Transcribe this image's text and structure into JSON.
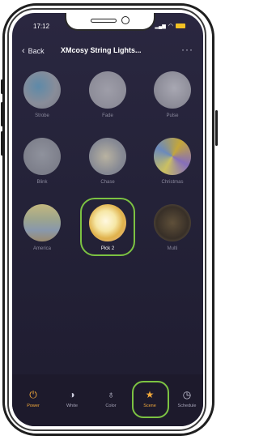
{
  "status": {
    "time": "17:12",
    "signal": "▂▄▆",
    "wifi": "wifi"
  },
  "nav": {
    "back_label": "Back",
    "title": "XMcosy String Lights...",
    "more": "···"
  },
  "scenes": [
    {
      "label": "Strobe",
      "selected": false,
      "bg": "radial-gradient(circle at 40% 40%,#6aa0c0,#9ea4ae 55%,#8c8c96)"
    },
    {
      "label": "Fade",
      "selected": false,
      "bg": "radial-gradient(circle at 50% 50%,#b8b8c0,#9a9aa4)"
    },
    {
      "label": "Pulse",
      "selected": false,
      "bg": "radial-gradient(circle at 55% 45%,#c4c4cc,#8e8e98)"
    },
    {
      "label": "Blink",
      "selected": false,
      "bg": "radial-gradient(circle at 50% 45%,#a6aab2,#868892)"
    },
    {
      "label": "Chase",
      "selected": false,
      "bg": "radial-gradient(circle at 45% 50%,#d9d2b8,#9ca0a8 60%,#8c8e96)"
    },
    {
      "label": "Christmas",
      "selected": false,
      "bg": "conic-gradient(from 30deg,#e8c33a,#9b7fd6,#f0e36a,#7aa0d8,#e8c33a)"
    },
    {
      "label": "America",
      "selected": false,
      "bg": "linear-gradient(180deg,#e6d88e,#b8c2a0 40%,#9fb2c6 70%,#b5a27a)"
    },
    {
      "label": "Pick 2",
      "selected": true,
      "bg": "radial-gradient(circle at 45% 45%,#fff8e0,#f6e7a6 35%,#e0b24c 60%,#e7b38a)"
    },
    {
      "label": "Multi",
      "selected": false,
      "bg": "radial-gradient(circle at 50% 50%,#6c5a3a,#3c3224 60%,#8a7a5a)"
    }
  ],
  "tabs": [
    {
      "label": "Power",
      "icon": "⏻",
      "name": "power-icon",
      "active": false
    },
    {
      "label": "White",
      "icon": "◑",
      "name": "white-icon",
      "active": false
    },
    {
      "label": "Color",
      "icon": "♁",
      "name": "color-bulb-icon",
      "active": false
    },
    {
      "label": "Scene",
      "icon": "★",
      "name": "star-icon",
      "active": true
    },
    {
      "label": "Schedule",
      "icon": "◷",
      "name": "clock-icon",
      "active": false
    }
  ],
  "colors": {
    "accent": "#f2a93b",
    "highlight": "#7cc242",
    "background": "#242238"
  }
}
